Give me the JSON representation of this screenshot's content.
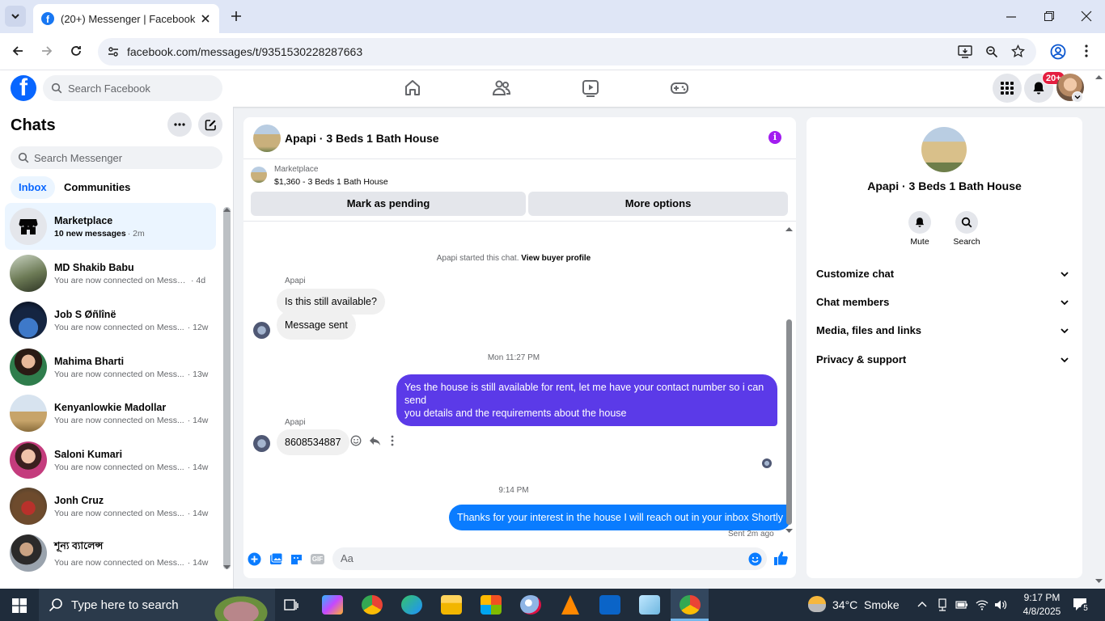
{
  "browser": {
    "tab_title": "(20+) Messenger | Facebook",
    "url": "facebook.com/messages/t/9351530228287663"
  },
  "fb": {
    "search_placeholder": "Search Facebook",
    "notif_badge": "20+"
  },
  "chats": {
    "title": "Chats",
    "search_placeholder": "Search Messenger",
    "tabs": [
      "Inbox",
      "Communities"
    ],
    "items": [
      {
        "name": "Marketplace",
        "preview": "10 new messages",
        "time": "· 2m",
        "bold": true
      },
      {
        "name": "MD Shakib Babu",
        "preview": "You are now connected on Messe...",
        "time": "· 4d"
      },
      {
        "name": "Job S Øñlînë",
        "preview": "You are now connected on Mess...",
        "time": "· 12w"
      },
      {
        "name": "Mahima Bharti",
        "preview": "You are now connected on Mess...",
        "time": "· 13w"
      },
      {
        "name": "Kenyanlowkie Madollar",
        "preview": "You are now connected on Mess...",
        "time": "· 14w"
      },
      {
        "name": "Saloni Kumari",
        "preview": "You are now connected on Mess...",
        "time": "· 14w"
      },
      {
        "name": "Jonh Cruz",
        "preview": "You are now connected on Mess...",
        "time": "· 14w"
      },
      {
        "name": "শূন্য ব্যালেন্স",
        "preview": "You are now connected on Mess...",
        "time": "· 14w"
      }
    ]
  },
  "conversation": {
    "title": "Apapi · 3 Beds 1 Bath House",
    "listing_label": "Marketplace",
    "listing_detail": "$1,360 - 3 Beds 1 Bath House",
    "mark_pending": "Mark as pending",
    "more_options": "More options",
    "started_text": "Apapi started this chat.",
    "view_buyer": "View buyer profile",
    "sender": "Apapi",
    "msg1": "Is this still available?",
    "msg2": "Message sent",
    "time1": "Mon 11:27 PM",
    "msg3_line1": "Yes the house is still available for rent, let me have your contact number so i can send",
    "msg3_line2": "you details and the requirements about the house",
    "msg4": "8608534887",
    "time2": "9:14 PM",
    "msg5": "Thanks for your interest in the house I will reach out in your inbox Shortly",
    "sent_status": "Sent 2m ago",
    "composer_placeholder": "Aa"
  },
  "details": {
    "title": "Apapi · 3 Beds 1 Bath House",
    "mute": "Mute",
    "search": "Search",
    "sections": [
      "Customize chat",
      "Chat members",
      "Media, files and links",
      "Privacy & support"
    ]
  },
  "taskbar": {
    "search_placeholder": "Type here to search",
    "weather": "34°C  Smoke",
    "time": "9:17 PM",
    "date": "4/8/2025",
    "notif_count": "5"
  },
  "colors": {
    "fb_blue": "#0866ff",
    "messenger_blue": "#0a7cff",
    "own_bubble_purple": "#5b3ae8",
    "info_purple": "#a21cf0"
  }
}
